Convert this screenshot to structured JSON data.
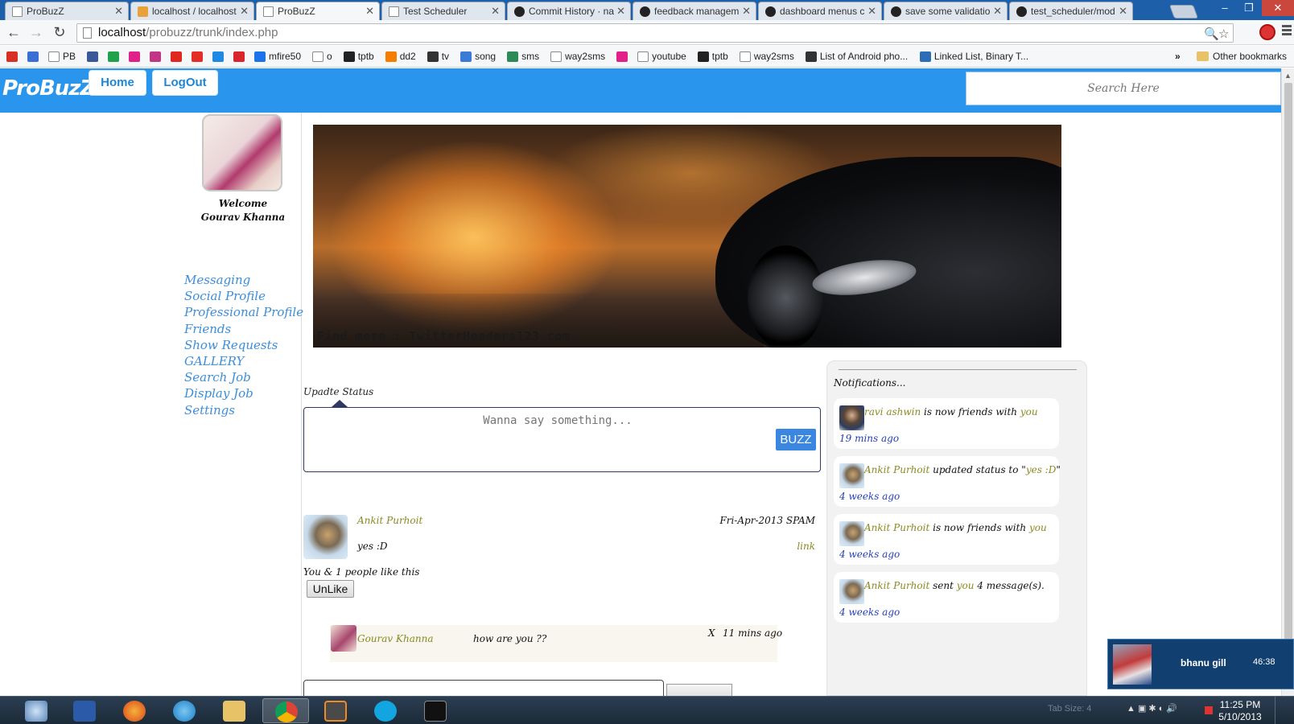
{
  "browser": {
    "tabs": [
      {
        "title": "ProBuzZ",
        "icon": "doc-icon"
      },
      {
        "title": "localhost / localhost",
        "icon": "phpmyadmin-icon"
      },
      {
        "title": "ProBuzZ",
        "icon": "doc-icon",
        "active": true
      },
      {
        "title": "Test Scheduler",
        "icon": "doc-icon"
      },
      {
        "title": "Commit History · na",
        "icon": "github-icon"
      },
      {
        "title": "feedback managem",
        "icon": "github-icon"
      },
      {
        "title": "dashboard menus c",
        "icon": "github-icon"
      },
      {
        "title": "save some validatio",
        "icon": "github-icon"
      },
      {
        "title": "test_scheduler/mod",
        "icon": "github-icon"
      }
    ],
    "url_host": "localhost",
    "url_path": "/probuzz/trunk/index.php",
    "bookmarks": [
      {
        "label": "",
        "icon": "gmail-icon",
        "color": "#d93025"
      },
      {
        "label": "",
        "icon": "google-plus-icon",
        "color": "#3b6fd6"
      },
      {
        "label": "PB",
        "icon": "doc-icon",
        "color": "#ffffff"
      },
      {
        "label": "",
        "icon": "facebook-icon",
        "color": "#3b5998"
      },
      {
        "label": "",
        "icon": "windows-icon",
        "color": "#1fa24a"
      },
      {
        "label": "",
        "icon": "circle-icon",
        "color": "#e0218a"
      },
      {
        "label": "",
        "icon": "instagram-icon",
        "color": "#c13584"
      },
      {
        "label": "",
        "icon": "flash-icon",
        "color": "#e0281f"
      },
      {
        "label": "",
        "icon": "youtube-icon",
        "color": "#e52d27"
      },
      {
        "label": "",
        "icon": "c-icon",
        "color": "#1e88e5"
      },
      {
        "label": "",
        "icon": "in-icon",
        "color": "#d9262c"
      },
      {
        "label": "mfire50",
        "icon": "mediafire-icon",
        "color": "#1a73e8"
      },
      {
        "label": "o",
        "icon": "doc-icon",
        "color": "#ffffff"
      },
      {
        "label": "tptb",
        "icon": "tptb-icon",
        "color": "#222222"
      },
      {
        "label": "dd2",
        "icon": "blogger-icon",
        "color": "#f57d00"
      },
      {
        "label": "tv",
        "icon": "ball-icon",
        "color": "#333333"
      },
      {
        "label": "song",
        "icon": "song-icon",
        "color": "#3a7bd5"
      },
      {
        "label": "sms",
        "icon": "sms-icon",
        "color": "#2e8b57"
      },
      {
        "label": "way2sms",
        "icon": "doc-icon",
        "color": "#ffffff"
      },
      {
        "label": "",
        "icon": "circle-icon",
        "color": "#e0218a"
      },
      {
        "label": "youtube",
        "icon": "doc-icon",
        "color": "#ffffff"
      },
      {
        "label": "tptb",
        "icon": "tptb-icon",
        "color": "#222222"
      },
      {
        "label": "way2sms",
        "icon": "doc-icon",
        "color": "#ffffff"
      },
      {
        "label": "List of Android pho...",
        "icon": "m-icon",
        "color": "#333333"
      },
      {
        "label": "Linked List, Binary T...",
        "icon": "h-icon",
        "color": "#2d6db5"
      }
    ],
    "more_bookmarks": "»",
    "other_bookmarks": "Other bookmarks"
  },
  "site": {
    "logo": "ProBuzZ",
    "nav": {
      "home": "Home",
      "logout": "LogOut"
    },
    "search_placeholder": "Search Here",
    "accent_color": "#2a95ec"
  },
  "sidebar": {
    "welcome": "Welcome",
    "user_name": "Gourav Khanna",
    "links": [
      "Messaging",
      "Social Profile",
      "Professional Profile",
      "Friends",
      "Show Requests",
      "GALLERY",
      "Search Job",
      "Display Job",
      "Settings"
    ]
  },
  "banner": {
    "credit": "Find more : TwitterHeaders123.com"
  },
  "status": {
    "label": "Upadte Status",
    "placeholder": "Wanna say something...",
    "button": "BUZZ"
  },
  "post": {
    "author": "Ankit Purhoit",
    "date": "Fri-Apr-2013  SPAM",
    "text": "yes :D",
    "link": "link",
    "likes": "You & 1 people like this",
    "unlike_button": "UnLike",
    "comment": {
      "author": "Gourav Khanna",
      "text": "how are you ??",
      "delete": "X",
      "time": "11 mins ago"
    }
  },
  "notifications": {
    "title": "Notifications...",
    "items": [
      {
        "actor": "ravi ashwin",
        "action": " is now friends with ",
        "target": "you",
        "tail": "",
        "time": "19 mins ago",
        "avatar": "ravi"
      },
      {
        "actor": "Ankit Purhoit",
        "action": " updated status to \"",
        "target": "yes :D",
        "tail": "\"",
        "time": "4 weeks ago",
        "avatar": "ankit"
      },
      {
        "actor": "Ankit Purhoit",
        "action": " is now friends with ",
        "target": "you",
        "tail": "",
        "time": "4 weeks ago",
        "avatar": "ankit"
      },
      {
        "actor": "Ankit Purhoit",
        "action": " sent ",
        "target": "you",
        "tail": " 4 message(s).",
        "time": "4 weeks ago",
        "avatar": "ankit"
      }
    ]
  },
  "chat_popup": {
    "name": "bhanu gill",
    "time": "46:38"
  },
  "taskbar": {
    "apps": [
      "search-icon",
      "word-icon",
      "firefox-icon",
      "ie-icon",
      "explorer-icon",
      "chrome-icon",
      "sublime-icon",
      "skype-icon",
      "cmd-icon"
    ],
    "tab_size": "Tab Size: 4",
    "clock_time": "11:25 PM",
    "clock_date": "5/10/2013"
  }
}
